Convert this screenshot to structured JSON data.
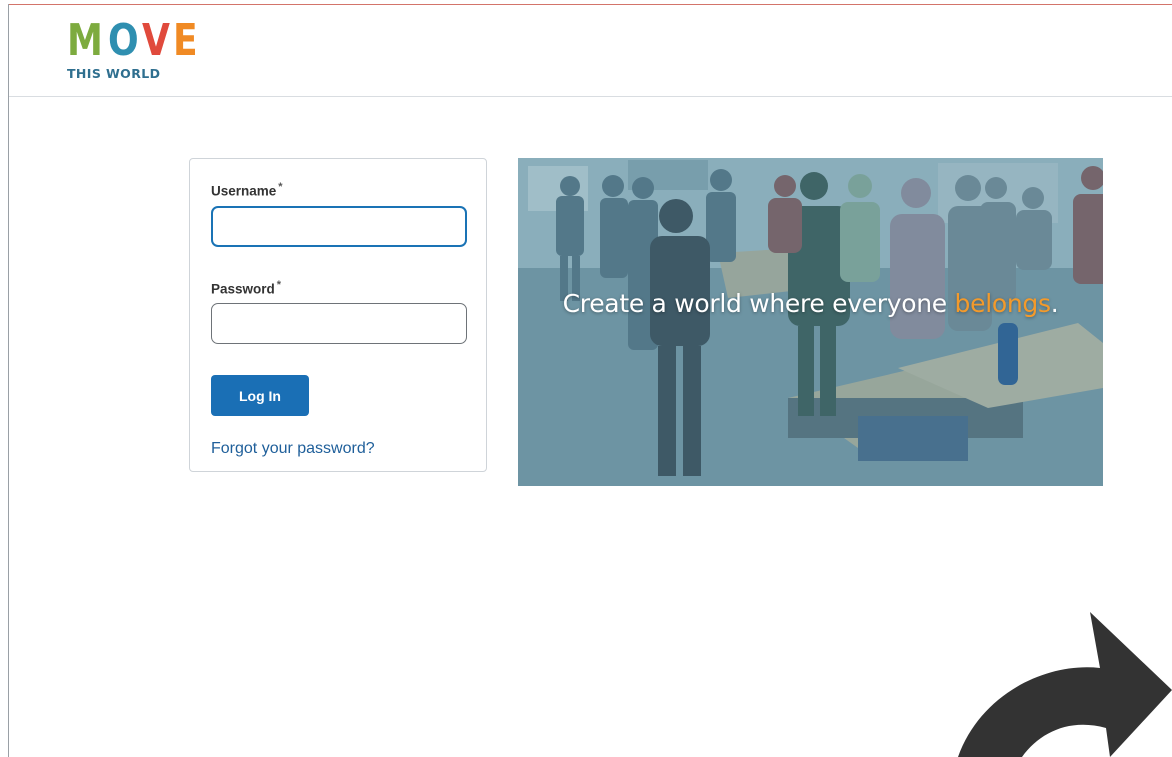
{
  "brand": {
    "logo_letters": [
      {
        "char": "M",
        "color": "#7dab3f"
      },
      {
        "char": "O",
        "color": "#2f8fb0"
      },
      {
        "char": "V",
        "color": "#e04a3c"
      },
      {
        "char": "E",
        "color": "#f08a24"
      }
    ],
    "logo_subtitle": "THIS WORLD"
  },
  "login": {
    "username_label": "Username",
    "username_required": "*",
    "username_value": "",
    "password_label": "Password",
    "password_required": "*",
    "password_value": "",
    "submit_label": "Log In",
    "forgot_link": "Forgot your password?"
  },
  "hero": {
    "tagline_main": "Create a world where everyone ",
    "tagline_accent": "belongs",
    "tagline_end": ".",
    "accent_color": "#f39a2b"
  },
  "overlay": {
    "icon": "curved-arrow-icon"
  }
}
